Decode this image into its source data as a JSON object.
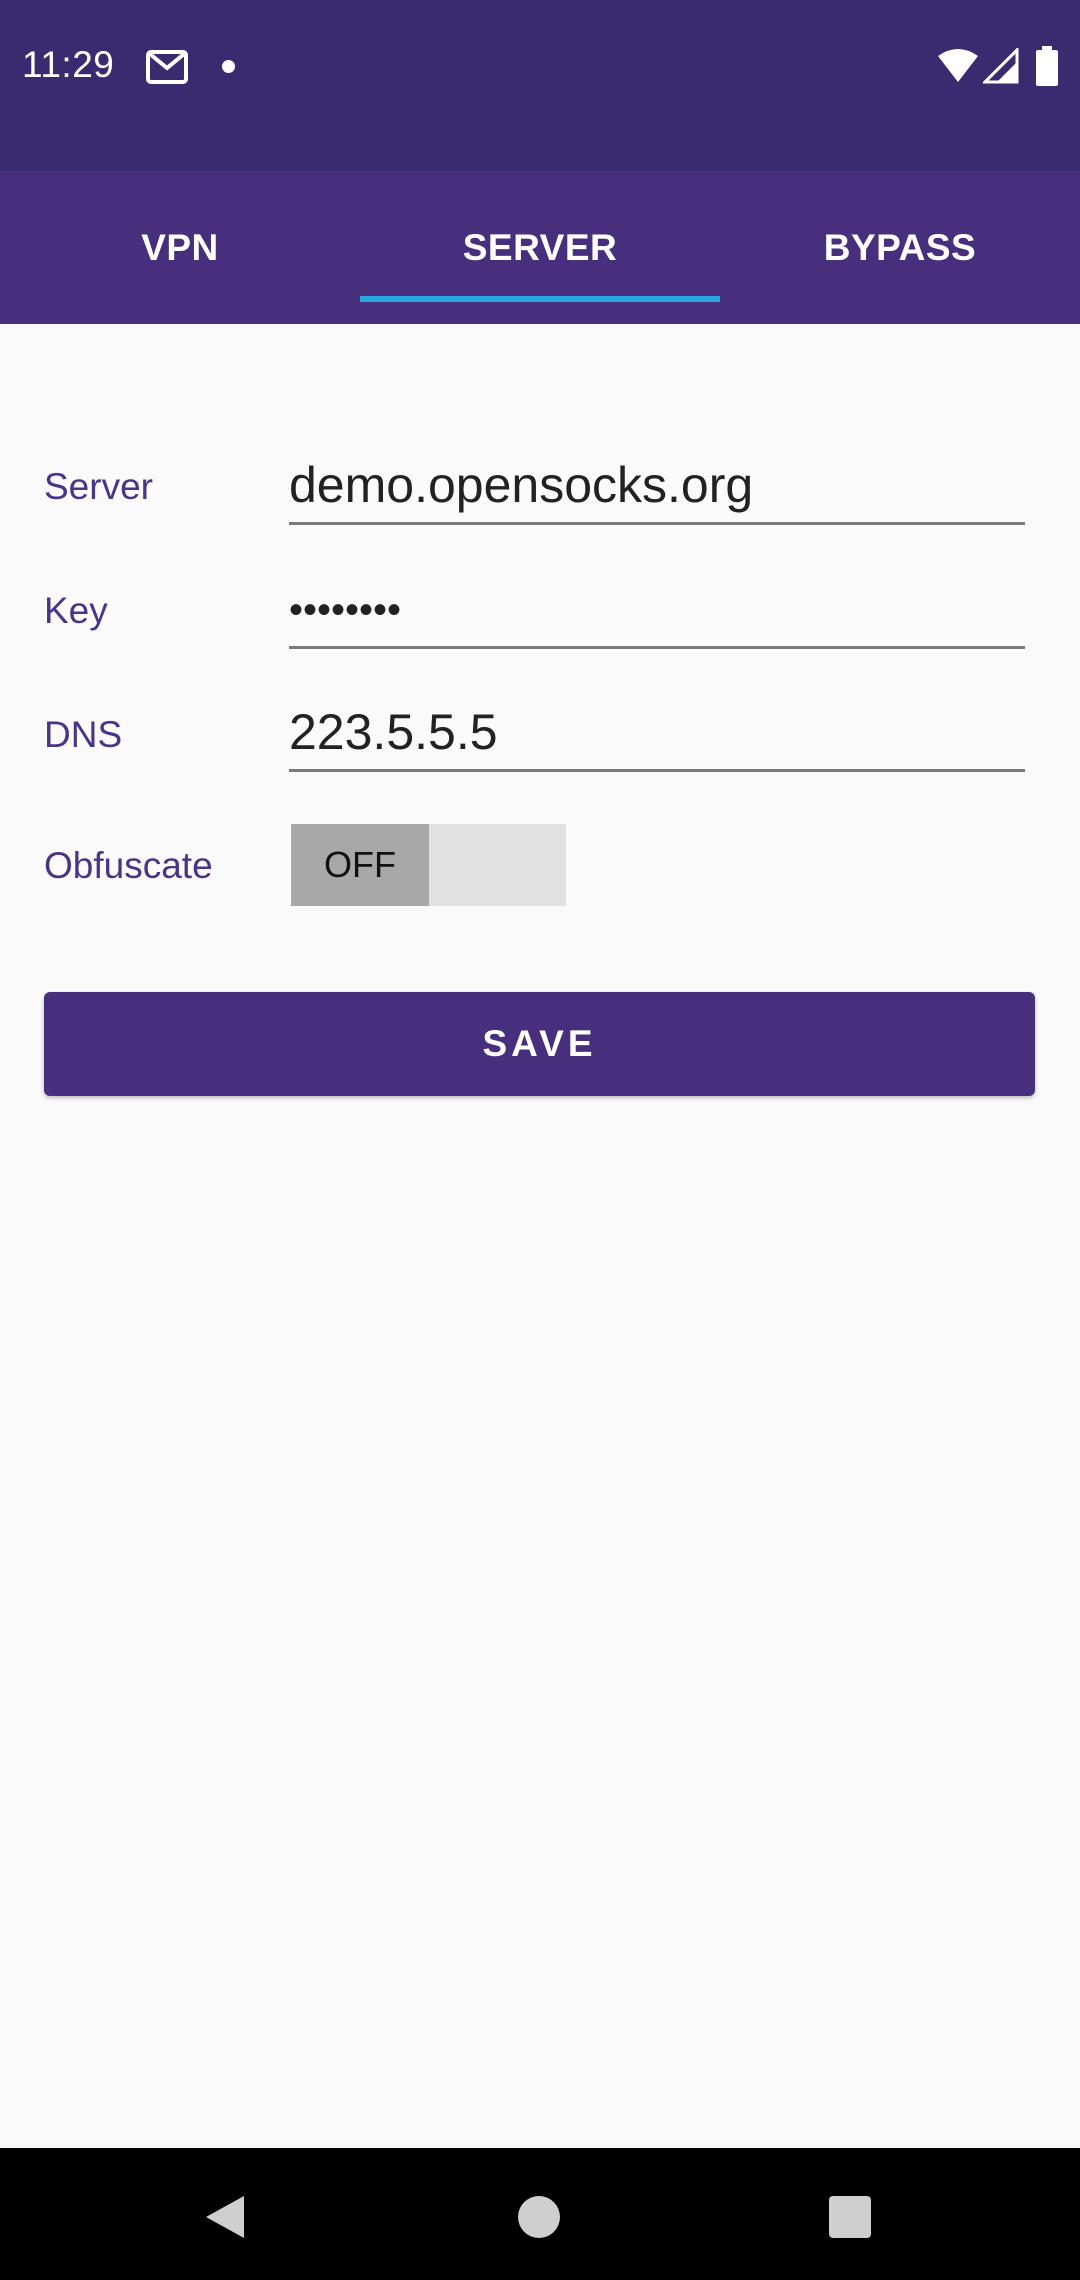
{
  "status_bar": {
    "time": "11:29",
    "icons": [
      "gmail-icon",
      "dot-icon",
      "wifi-icon",
      "signal-icon",
      "battery-icon"
    ]
  },
  "tabs": [
    {
      "label": "VPN",
      "selected": false
    },
    {
      "label": "SERVER",
      "selected": true
    },
    {
      "label": "BYPASS",
      "selected": false
    }
  ],
  "form": {
    "server_label": "Server",
    "server_value": "demo.opensocks.org",
    "key_label": "Key",
    "key_value": "••••••••",
    "dns_label": "DNS",
    "dns_value": "223.5.5.5",
    "obfuscate_label": "Obfuscate",
    "obfuscate_state": "OFF"
  },
  "save_button": "SAVE",
  "colors": {
    "status_bar": "#3a2b70",
    "primary": "#472f7d",
    "tab_indicator": "#29a8e0",
    "label": "#4a3487"
  }
}
